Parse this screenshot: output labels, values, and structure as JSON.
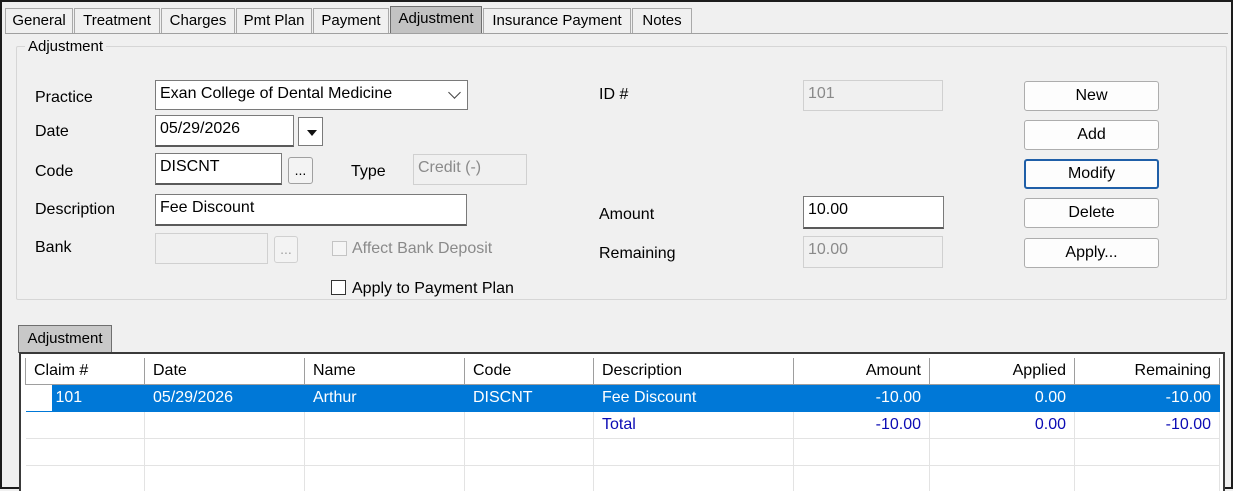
{
  "tabs": [
    {
      "label": "General",
      "active": false
    },
    {
      "label": "Treatment",
      "active": false
    },
    {
      "label": "Charges",
      "active": false
    },
    {
      "label": "Pmt Plan",
      "active": false
    },
    {
      "label": "Payment",
      "active": false
    },
    {
      "label": "Adjustment",
      "active": true
    },
    {
      "label": "Insurance Payment",
      "active": false
    },
    {
      "label": "Notes",
      "active": false
    }
  ],
  "group": {
    "title": "Adjustment"
  },
  "form": {
    "practice_label": "Practice",
    "practice_value": "Exan College of Dental Medicine",
    "date_label": "Date",
    "date_value": "05/29/2026",
    "code_label": "Code",
    "code_value": "DISCNT",
    "code_browse": "...",
    "type_label": "Type",
    "type_value": "Credit (-)",
    "description_label": "Description",
    "description_value": "Fee Discount",
    "bank_label": "Bank",
    "bank_value": "",
    "bank_browse": "...",
    "affect_bank_label": "Affect Bank Deposit",
    "apply_plan_label": "Apply to Payment Plan",
    "id_label": "ID #",
    "id_value": "101",
    "amount_label": "Amount",
    "amount_value": "10.00",
    "remaining_label": "Remaining",
    "remaining_value": "10.00"
  },
  "buttons": {
    "new": "New",
    "add": "Add",
    "modify": "Modify",
    "delete": "Delete",
    "apply": "Apply..."
  },
  "grid": {
    "tab_label": "Adjustment",
    "columns": [
      "Claim #",
      "Date",
      "Name",
      "Code",
      "Description",
      "Amount",
      "Applied",
      "Remaining"
    ],
    "rows": [
      {
        "claim": "101",
        "date": "05/29/2026",
        "name": "Arthur",
        "code": "DISCNT",
        "description": "Fee Discount",
        "amount": "-10.00",
        "applied": "0.00",
        "remaining": "-10.00"
      }
    ],
    "total": {
      "label": "Total",
      "amount": "-10.00",
      "applied": "0.00",
      "remaining": "-10.00"
    }
  }
}
